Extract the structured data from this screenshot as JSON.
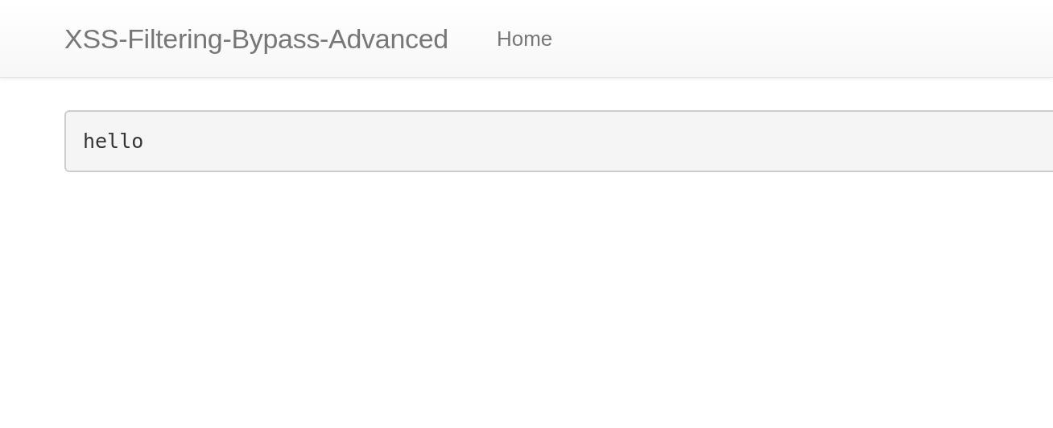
{
  "navbar": {
    "brand": "XSS-Filtering-Bypass-Advanced",
    "links": [
      {
        "label": "Home"
      }
    ]
  },
  "output": {
    "text": "hello"
  }
}
